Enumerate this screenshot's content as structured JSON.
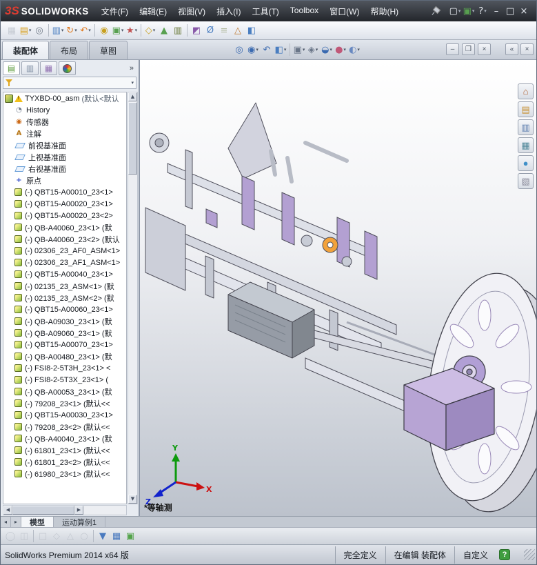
{
  "titlebar": {
    "logo_mark": "3S",
    "logo_text": "SOLIDWORKS",
    "menus": [
      "文件(F)",
      "编辑(E)",
      "视图(V)",
      "插入(I)",
      "工具(T)",
      "Toolbox",
      "窗口(W)",
      "帮助(H)"
    ],
    "window_icons": [
      {
        "name": "new-document",
        "glyph": "▢",
        "color": "#e8ecf2",
        "caret": true
      },
      {
        "name": "file-properties",
        "glyph": "▣",
        "color": "#58a050",
        "caret": true
      },
      {
        "name": "help",
        "glyph": "?",
        "color": "#e8ecf2",
        "caret": true
      },
      {
        "name": "minimize",
        "glyph": "–",
        "color": "#e8ecf2"
      },
      {
        "name": "maximize",
        "glyph": "□",
        "color": "#e8ecf2"
      },
      {
        "name": "close",
        "glyph": "×",
        "color": "#e8ecf2"
      }
    ]
  },
  "main_toolbar": {
    "icons": [
      {
        "name": "edit-component",
        "glyph": "▦",
        "color": "#9aa2ae",
        "dim": true
      },
      {
        "name": "open-document",
        "glyph": "▤",
        "color": "#d8a020",
        "caret": true
      },
      {
        "name": "attachment",
        "glyph": "◎",
        "color": "#707a88"
      },
      {
        "name": "component-pattern",
        "glyph": "▥",
        "color": "#4a7ec0",
        "caret": true,
        "sep": true
      },
      {
        "name": "rotate-component",
        "glyph": "↻",
        "color": "#e07a20",
        "caret": true
      },
      {
        "name": "move-component",
        "glyph": "↶",
        "color": "#e07a20",
        "caret": true
      },
      {
        "name": "mate",
        "glyph": "◉",
        "color": "#c8a020",
        "sep": true
      },
      {
        "name": "insert-component",
        "glyph": "▣",
        "color": "#58a050",
        "caret": true
      },
      {
        "name": "smart-fasteners",
        "glyph": "★",
        "color": "#c05050",
        "caret": true
      },
      {
        "name": "reference-geometry",
        "glyph": "◇",
        "color": "#c8a020",
        "caret": true,
        "sep": true
      },
      {
        "name": "assembly-features",
        "glyph": "▲",
        "color": "#58a050"
      },
      {
        "name": "bill-of-materials",
        "glyph": "▥",
        "color": "#6a7a3a"
      },
      {
        "name": "interference-detection",
        "glyph": "◩",
        "color": "#8858a8",
        "sep": true
      },
      {
        "name": "measure",
        "glyph": "Ø",
        "color": "#4a7ec0"
      },
      {
        "name": "mass-properties",
        "glyph": "≡",
        "color": "#6a7a3a",
        "dim": true
      },
      {
        "name": "exploded-view",
        "glyph": "△",
        "color": "#c07830"
      },
      {
        "name": "section-tool",
        "glyph": "◧",
        "color": "#4a7ec0"
      }
    ]
  },
  "command_manager": {
    "tabs": [
      {
        "label": "装配体",
        "active": true
      },
      {
        "label": "布局",
        "active": false
      },
      {
        "label": "草图",
        "active": false
      }
    ]
  },
  "headsup": {
    "icons": [
      {
        "name": "zoom-fit",
        "glyph": "◎",
        "color": "#3a6ab0"
      },
      {
        "name": "zoom-area",
        "glyph": "◉",
        "color": "#3a6ab0",
        "caret": true
      },
      {
        "name": "previous-view",
        "glyph": "↶",
        "color": "#3a6ab0"
      },
      {
        "name": "section-view",
        "glyph": "◧",
        "color": "#4a7ec0",
        "caret": true
      },
      {
        "name": "view-orientation",
        "glyph": "▣",
        "color": "#6a7688",
        "caret": true,
        "sep": true
      },
      {
        "name": "display-style",
        "glyph": "◈",
        "color": "#6a7688",
        "caret": true
      },
      {
        "name": "hide-show-items",
        "glyph": "◒",
        "color": "#3a6ab0",
        "caret": true
      },
      {
        "name": "edit-appearance",
        "glyph": "●",
        "color": "#c05878",
        "caret": true
      },
      {
        "name": "apply-scene",
        "glyph": "◐",
        "color": "#6888c0",
        "caret": true
      }
    ]
  },
  "doc_window_icons": [
    {
      "name": "doc-minimize",
      "glyph": "–"
    },
    {
      "name": "doc-restore",
      "glyph": "❐"
    },
    {
      "name": "doc-close",
      "glyph": "×"
    }
  ],
  "taskpane_toggle_icons": [
    {
      "name": "taskpane-collapse",
      "glyph": "«"
    },
    {
      "name": "taskpane-close",
      "glyph": "×"
    }
  ],
  "left_panel": {
    "overflow": "»",
    "tree": {
      "root": {
        "label": "TYXBD-00_asm",
        "suffix": "(默认<默认"
      },
      "items": [
        {
          "label": "History",
          "icon": "history"
        },
        {
          "label": "传感器",
          "icon": "sensors"
        },
        {
          "label": "注解",
          "icon": "annotations"
        },
        {
          "label": "前视基准面",
          "icon": "plane"
        },
        {
          "label": "上视基准面",
          "icon": "plane"
        },
        {
          "label": "右视基准面",
          "icon": "plane"
        },
        {
          "label": "原点",
          "icon": "origin"
        },
        {
          "label": "(-) QBT15-A00010_23<1>",
          "icon": "part"
        },
        {
          "label": "(-) QBT15-A00020_23<1>",
          "icon": "part"
        },
        {
          "label": "(-) QBT15-A00020_23<2>",
          "icon": "part"
        },
        {
          "label": "(-) QB-A40060_23<1> (默",
          "icon": "part"
        },
        {
          "label": "(-) QB-A40060_23<2> (默认",
          "icon": "part"
        },
        {
          "label": "(-) 02306_23_AF0_ASM<1>",
          "icon": "part"
        },
        {
          "label": "(-) 02306_23_AF1_ASM<1>",
          "icon": "part"
        },
        {
          "label": "(-) QBT15-A00040_23<1>",
          "icon": "part"
        },
        {
          "label": "(-) 02135_23_ASM<1> (默",
          "icon": "part"
        },
        {
          "label": "(-) 02135_23_ASM<2> (默",
          "icon": "part"
        },
        {
          "label": "(-) QBT15-A00060_23<1>",
          "icon": "part"
        },
        {
          "label": "(-) QB-A09030_23<1> (默",
          "icon": "part"
        },
        {
          "label": "(-) QB-A09060_23<1> (默",
          "icon": "part"
        },
        {
          "label": "(-) QBT15-A00070_23<1>",
          "icon": "part"
        },
        {
          "label": "(-) QB-A00480_23<1> (默",
          "icon": "part"
        },
        {
          "label": "(-) FSI8-2-5T3H_23<1> <",
          "icon": "part"
        },
        {
          "label": "(-) FSI8-2-5T3X_23<1> (",
          "icon": "part"
        },
        {
          "label": "(-) QB-A00053_23<1> (默",
          "icon": "part"
        },
        {
          "label": "(-) 79208_23<1> (默认<<",
          "icon": "part"
        },
        {
          "label": "(-) QBT15-A00030_23<1>",
          "icon": "part"
        },
        {
          "label": "(-) 79208_23<2> (默认<<",
          "icon": "part"
        },
        {
          "label": "(-) QB-A40040_23<1> (默",
          "icon": "part"
        },
        {
          "label": "(-) 61801_23<1> (默认<<",
          "icon": "part"
        },
        {
          "label": "(-) 61801_23<2> (默认<<",
          "icon": "part"
        },
        {
          "label": "(-) 61980_23<1> (默认<<",
          "icon": "part"
        }
      ]
    }
  },
  "viewport": {
    "view_label": "*等轴测",
    "triad": {
      "x": "X",
      "y": "Y",
      "z": "Z"
    },
    "colors": {
      "triad_x": "#cc1111",
      "triad_y": "#0d9a0d",
      "triad_z": "#1122cc",
      "part_purple": "#b3a0d2",
      "part_gray": "#dcdfe8"
    }
  },
  "taskpane": {
    "icons": [
      {
        "name": "solidworks-resources",
        "glyph": "⌂",
        "color": "#b06030"
      },
      {
        "name": "design-library",
        "glyph": "▤",
        "color": "#c89030"
      },
      {
        "name": "file-explorer",
        "glyph": "▥",
        "color": "#6080b0"
      },
      {
        "name": "view-palette",
        "glyph": "▦",
        "color": "#50889a"
      },
      {
        "name": "appearances-scenes",
        "glyph": "●",
        "color": "#4090c8"
      },
      {
        "name": "custom-properties",
        "glyph": "▧",
        "color": "#888898"
      }
    ]
  },
  "model_tabs": {
    "nav": [
      {
        "name": "tabs-scroll-left",
        "glyph": "◂"
      },
      {
        "name": "tabs-scroll-right",
        "glyph": "▸"
      }
    ],
    "tabs": [
      {
        "label": "模型",
        "active": true
      },
      {
        "label": "运动算例1",
        "active": false
      }
    ]
  },
  "bottom_toolbar": {
    "icons": [
      {
        "name": "mask-tool",
        "glyph": "◯",
        "color": "#a8aeb8",
        "dim": true
      },
      {
        "name": "pair-tool",
        "glyph": "◫",
        "color": "#a8aeb8",
        "dim": true
      },
      {
        "name": "frame-tool",
        "glyph": "□",
        "color": "#a8aeb8",
        "dim": true,
        "sep": true
      },
      {
        "name": "diamond-tool",
        "glyph": "◇",
        "color": "#a8aeb8",
        "dim": true
      },
      {
        "name": "triangle-tool",
        "glyph": "△",
        "color": "#a8aeb8",
        "dim": true
      },
      {
        "name": "circle-tool",
        "glyph": "○",
        "color": "#a8aeb8",
        "dim": true
      },
      {
        "name": "filter-toggle",
        "glyph": "▼",
        "color": "#4a7abf",
        "sep": true
      },
      {
        "name": "grid-toggle",
        "glyph": "▦",
        "color": "#4a7abf"
      },
      {
        "name": "notes-toggle",
        "glyph": "▣",
        "color": "#53a34a"
      }
    ]
  },
  "status_bar": {
    "app": "SolidWorks Premium 2014 x64 版",
    "define_state": "完全定义",
    "edit_state": "在编辑 装配体",
    "custom": "自定义",
    "help_glyph": "?"
  }
}
